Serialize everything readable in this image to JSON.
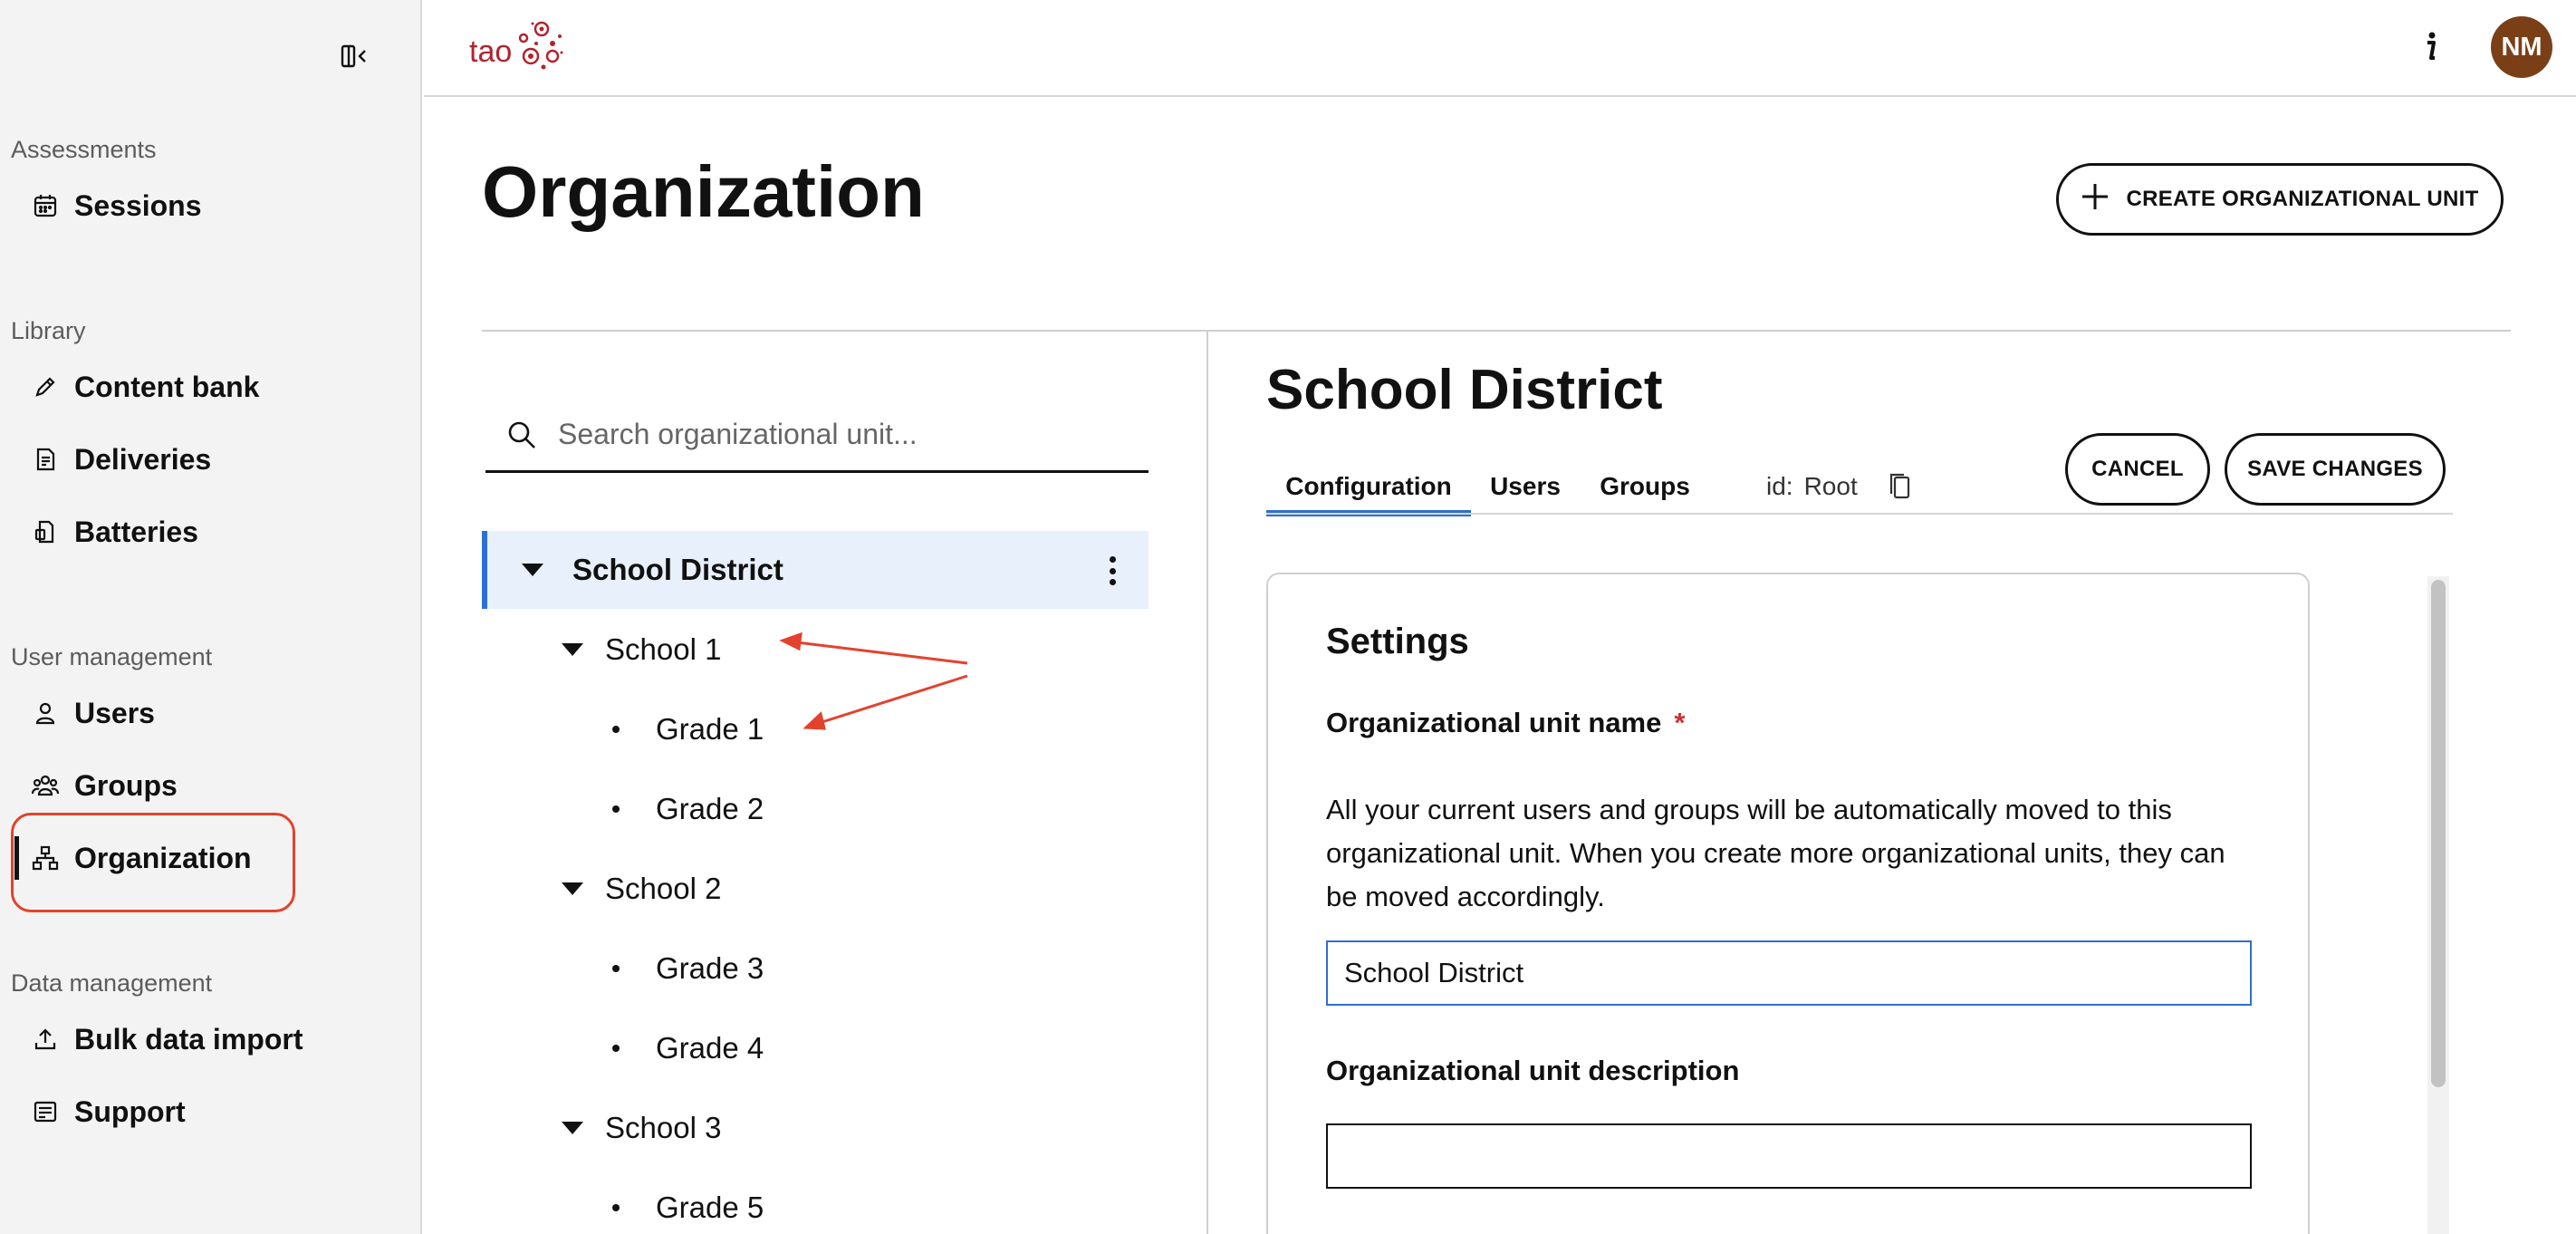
{
  "sidebar": {
    "sections": [
      {
        "label": "Assessments",
        "items": [
          {
            "label": "Sessions",
            "icon": "calendar-icon"
          }
        ]
      },
      {
        "label": "Library",
        "items": [
          {
            "label": "Content bank",
            "icon": "pencil-icon"
          },
          {
            "label": "Deliveries",
            "icon": "document-list-icon"
          },
          {
            "label": "Batteries",
            "icon": "battery-document-icon"
          }
        ]
      },
      {
        "label": "User management",
        "items": [
          {
            "label": "Users",
            "icon": "user-icon"
          },
          {
            "label": "Groups",
            "icon": "groups-icon"
          },
          {
            "label": "Organization",
            "icon": "org-chart-icon"
          }
        ]
      },
      {
        "label": "Data management",
        "items": [
          {
            "label": "Bulk data import",
            "icon": "upload-icon"
          },
          {
            "label": "Support",
            "icon": "support-form-icon"
          }
        ]
      }
    ],
    "active_item": "Organization"
  },
  "header": {
    "logo_text": "tao",
    "user_initials": "NM",
    "avatar_color": "#7b3f17"
  },
  "main": {
    "title": "Organization",
    "create_button": "CREATE ORGANIZATIONAL UNIT",
    "search_placeholder": "Search organizational unit...",
    "tree": [
      {
        "label": "School District",
        "level": 0,
        "type": "expanded",
        "selected": true
      },
      {
        "label": "School 1",
        "level": 1,
        "type": "expanded"
      },
      {
        "label": "Grade 1",
        "level": 2,
        "type": "leaf"
      },
      {
        "label": "Grade 2",
        "level": 2,
        "type": "leaf"
      },
      {
        "label": "School 2",
        "level": 1,
        "type": "expanded"
      },
      {
        "label": "Grade 3",
        "level": 2,
        "type": "leaf"
      },
      {
        "label": "Grade 4",
        "level": 2,
        "type": "leaf"
      },
      {
        "label": "School 3",
        "level": 1,
        "type": "expanded"
      },
      {
        "label": "Grade 5",
        "level": 2,
        "type": "leaf"
      }
    ]
  },
  "detail": {
    "title": "School District",
    "tabs": [
      "Configuration",
      "Users",
      "Groups"
    ],
    "active_tab": "Configuration",
    "id_label": "id:",
    "id_value": "Root",
    "cancel_label": "CANCEL",
    "save_label": "SAVE CHANGES",
    "settings": {
      "title": "Settings",
      "name_label": "Organizational unit name",
      "required_mark": "*",
      "help_text": "All your current users and groups will be automatically moved to this organizational unit. When you create more organizational units, they can be moved accordingly.",
      "name_value": "School District",
      "description_label": "Organizational unit description",
      "description_value": ""
    }
  },
  "colors": {
    "accent": "#2e6fd1",
    "annotation": "#e3422d",
    "sidebar_bg": "#f3f3f3",
    "selected_row_bg": "#e7f0fb"
  }
}
